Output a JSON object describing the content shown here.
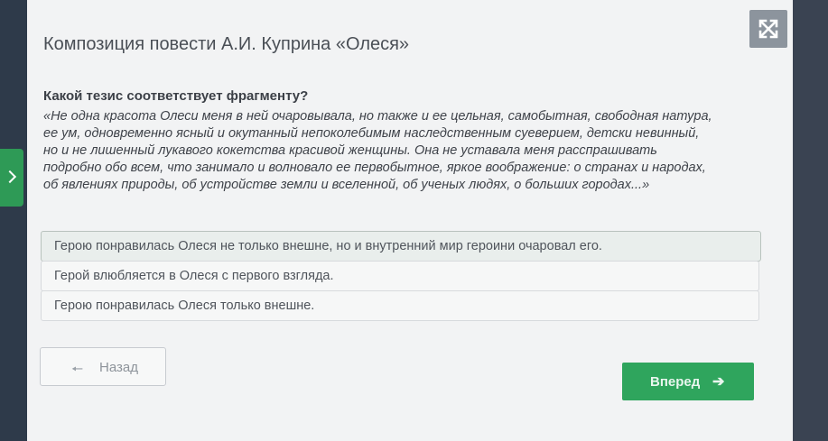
{
  "lesson": {
    "title": "Композиция повести А.И. Куприна «Олеся»"
  },
  "toolbar": {
    "expand_icon": "expand-arrows-icon"
  },
  "question": {
    "prompt": "Какой тезис соответствует фрагменту?",
    "quote_lines": [
      "«Не одна красота Олеси меня в ней очаровывала, но также и ее цельная, самобытная, свободная натура,",
      "ее ум, одновременно ясный и окутанный непоколебимым наследственным суеверием, детски невинный,",
      "но и не лишенный лукавого кокетства красивой женщины. Она не уставала меня расспрашивать",
      "подробно обо всем, что занимало и волновало ее первобытное, яркое воображение: о странах и народах,",
      "об явлениях природы, об устройстве земли и вселенной, об ученых людях, о больших городах...»"
    ]
  },
  "answers": [
    {
      "label": "Герою понравилась Олеся не только внешне, но и внутренний мир героини очаровал его.",
      "selected": true
    },
    {
      "label": "Герой влюбляется в Олеся с первого взгляда.",
      "selected": false
    },
    {
      "label": "Герою понравилась Олеся только внешне.",
      "selected": false
    }
  ],
  "nav": {
    "back_label": "Назад",
    "back_icon": "arrow-left-icon",
    "next_label": "Вперед",
    "next_icon": "arrow-right-icon"
  },
  "colors": {
    "accent_green": "#2fa55d",
    "background_dark": "#2c3340",
    "card": "#f2f3f4"
  }
}
